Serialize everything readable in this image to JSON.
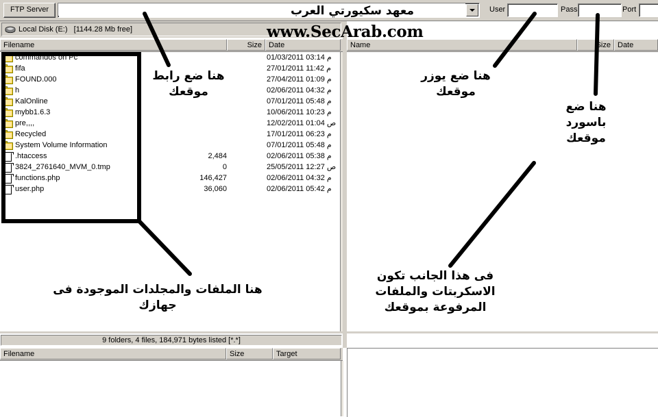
{
  "toolbar": {
    "ftp_server_button": "FTP Server",
    "host_value": "",
    "host_placeholder": "",
    "dropdown_icon": "chevron-down-icon",
    "user_label": "User",
    "user_value": "",
    "pass_label": "Pass",
    "pass_value": "",
    "port_label": "Port",
    "port_value": ""
  },
  "branding": {
    "arabic": "معهد سكيورتي العرب",
    "english": "www.SecArab.com"
  },
  "local": {
    "drive_icon": "disk-drive-icon",
    "drive_text": "Local Disk (E:)   [1144.28 Mb free]",
    "columns": [
      "Filename",
      "Size",
      "Date"
    ],
    "rows": [
      {
        "icon": "folder-icon",
        "name": "commandos on Pc",
        "size": "",
        "date": "01/03/2011 03:14 م"
      },
      {
        "icon": "folder-icon",
        "name": "fifa",
        "size": "",
        "date": "27/01/2011 11:42 م"
      },
      {
        "icon": "folder-icon",
        "name": "FOUND.000",
        "size": "",
        "date": "27/04/2011 01:09 م"
      },
      {
        "icon": "folder-icon",
        "name": "h",
        "size": "",
        "date": "02/06/2011 04:32 م"
      },
      {
        "icon": "folder-icon",
        "name": "KalOnline",
        "size": "",
        "date": "07/01/2011 05:48 م"
      },
      {
        "icon": "folder-icon",
        "name": "mybb1.6.3",
        "size": "",
        "date": "10/06/2011 10:23 م"
      },
      {
        "icon": "folder-icon",
        "name": "pre,,,,",
        "size": "",
        "date": "12/02/2011 01:04 ص"
      },
      {
        "icon": "folder-icon",
        "name": "Recycled",
        "size": "",
        "date": "17/01/2011 06:23 م"
      },
      {
        "icon": "folder-icon",
        "name": "System Volume Information",
        "size": "",
        "date": "07/01/2011 05:48 م"
      },
      {
        "icon": "file-icon",
        "name": ".htaccess",
        "size": "2,484",
        "date": "02/06/2011 05:38 م"
      },
      {
        "icon": "file-icon",
        "name": "3824_2761640_MVM_0.tmp",
        "size": "0",
        "date": "25/05/2011 12:27 ص"
      },
      {
        "icon": "file-icon",
        "name": "functions.php",
        "size": "146,427",
        "date": "02/06/2011 04:32 م"
      },
      {
        "icon": "file-icon",
        "name": "user.php",
        "size": "36,060",
        "date": "02/06/2011 05:42 م"
      }
    ],
    "status": "9 folders, 4 files, 184,971 bytes listed [*.*]"
  },
  "remote": {
    "columns": [
      "Name",
      "Size",
      "Date"
    ],
    "rows": []
  },
  "queue": {
    "columns": [
      "Filename",
      "Size",
      "Target"
    ],
    "rows": []
  },
  "annotations": [
    {
      "id": "anno-host",
      "text": "هنا ضع رابط\nموقعك"
    },
    {
      "id": "anno-user",
      "text": "هنا ضع يوزر\nموقعك"
    },
    {
      "id": "anno-pass",
      "text": "هنا ضع\nباسورد\nموقعك"
    },
    {
      "id": "anno-local",
      "text": "هنا الملفات والمجلدات الموجودة فى\nجهازك"
    },
    {
      "id": "anno-remote",
      "text": "فى هذا الجانب تكون\nالاسكربتات والملفات\nالمرفوعة بموقعك"
    }
  ],
  "colors": {
    "window_face": "#d4d0c8",
    "list_background": "#ffffff",
    "folder": "#ffcc33",
    "annotation_ink": "#000000"
  }
}
